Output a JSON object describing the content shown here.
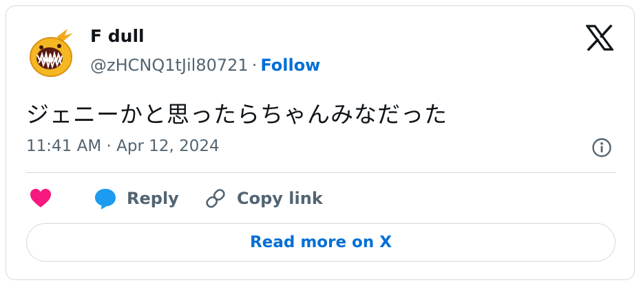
{
  "tweet": {
    "author": {
      "display_name": "F dull",
      "handle": "@zHCNQ1tJil80721",
      "separator": "·",
      "follow_label": "Follow",
      "avatar_icon": "yellow-monster-avatar"
    },
    "text": "ジェニーかと思ったらちゃんみなだった",
    "timestamp": "11:41 AM · Apr 12, 2024",
    "brand_icon": "x-logo-icon",
    "info_icon": "info-icon"
  },
  "actions": {
    "like_icon": "heart-icon",
    "reply_label": "Reply",
    "reply_icon": "speech-bubble-icon",
    "copy_label": "Copy link",
    "copy_icon": "link-icon"
  },
  "footer": {
    "read_more_label": "Read more on X"
  },
  "colors": {
    "link": "#006fd6",
    "like": "#f91880",
    "reply": "#1d9bf0",
    "muted_text": "#536471",
    "border": "#cfd9de",
    "avatar": "#f2b820"
  }
}
